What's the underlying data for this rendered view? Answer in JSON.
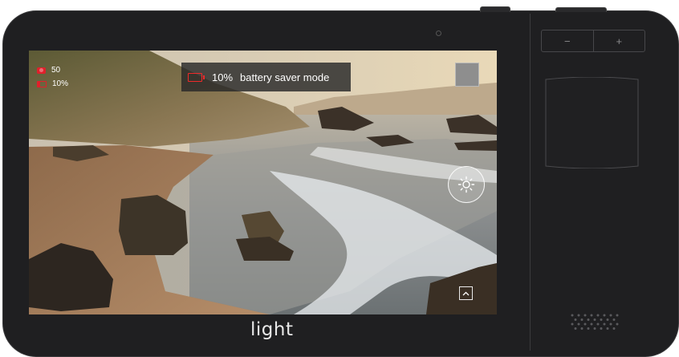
{
  "camera_overlay": {
    "iso_value": "50",
    "battery_small_percent": "10%",
    "banner": {
      "percent": "10%",
      "label": "battery saver mode"
    }
  },
  "right_panel": {
    "zoom_minus": "−",
    "zoom_plus": "+"
  },
  "brand": {
    "logo_text": "light"
  },
  "colors": {
    "body": "#1f1f21",
    "warning_red": "#ef2a2a",
    "banner_bg": "#282828"
  },
  "icons": [
    "record-icon",
    "battery-icon",
    "exposure-sun-icon",
    "chevron-up-icon",
    "gallery-thumbnail"
  ]
}
